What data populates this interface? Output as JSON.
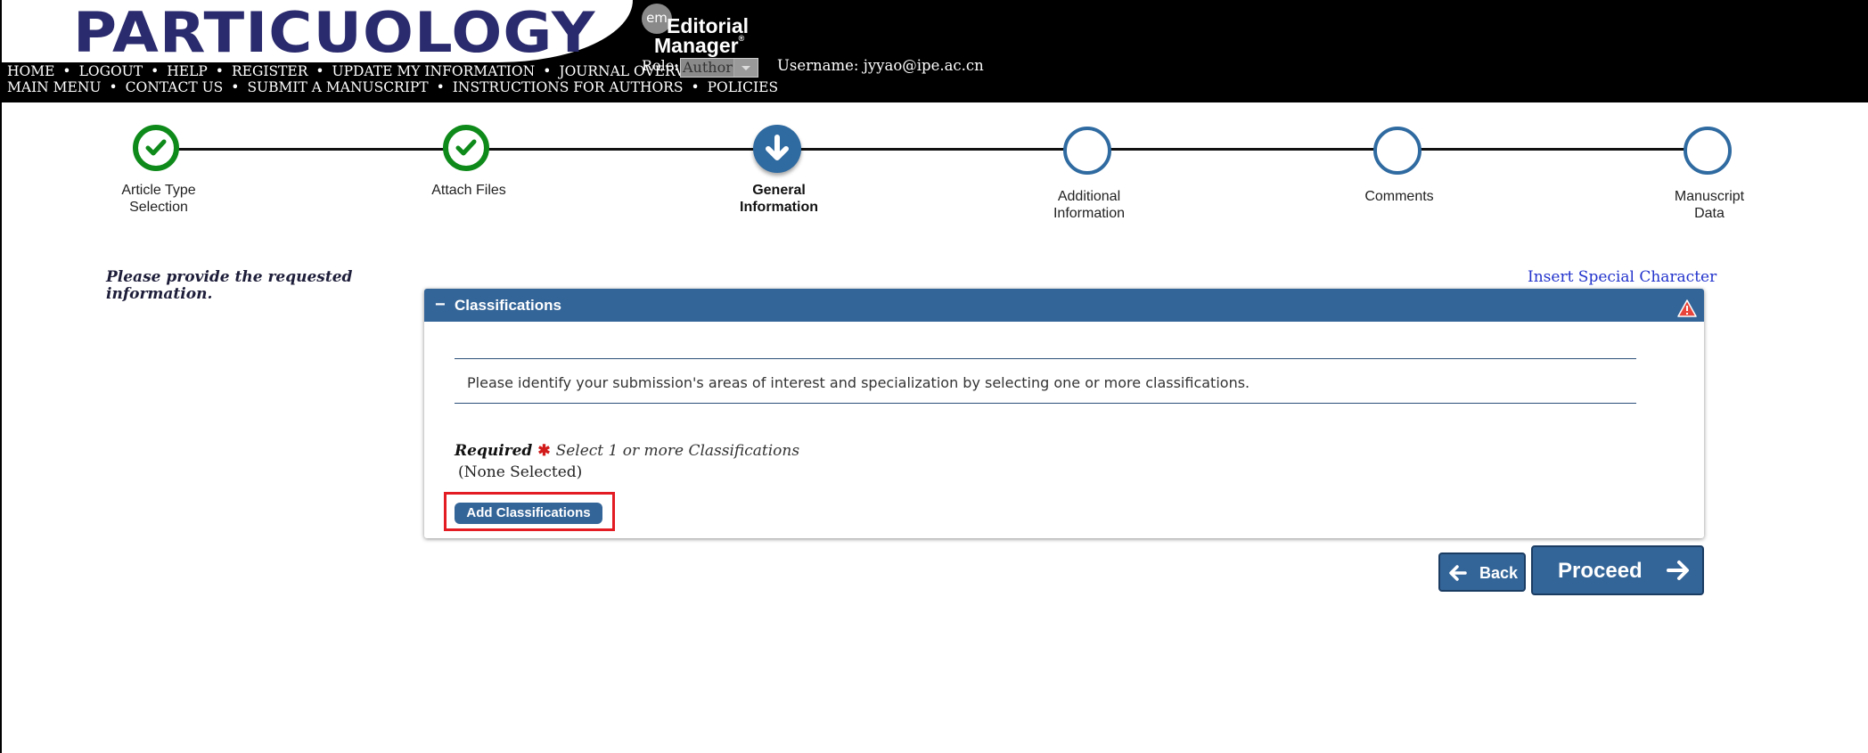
{
  "header": {
    "journal_logo": "PARTICUOLOGY",
    "em_badge": "em",
    "em_line1": "Editorial",
    "em_line2": "Manager",
    "em_mark": "®",
    "role_label": "Role:",
    "role_value": "Author",
    "username_label": "Username:",
    "username_value": "jyyao@ipe.ac.cn",
    "nav_row1": [
      "HOME",
      "LOGOUT",
      "HELP",
      "REGISTER",
      "UPDATE MY INFORMATION",
      "JOURNAL OVERVIEW"
    ],
    "nav_row2": [
      "MAIN MENU",
      "CONTACT US",
      "SUBMIT A MANUSCRIPT",
      "INSTRUCTIONS FOR AUTHORS",
      "POLICIES"
    ],
    "nav_separator": "•"
  },
  "steps": [
    {
      "label_line1": "Article Type",
      "label_line2": "Selection",
      "status": "done"
    },
    {
      "label_line1": "Attach Files",
      "label_line2": "",
      "status": "done"
    },
    {
      "label_line1": "General",
      "label_line2": "Information",
      "status": "current"
    },
    {
      "label_line1": "Additional",
      "label_line2": "Information",
      "status": "pending"
    },
    {
      "label_line1": "Comments",
      "label_line2": "",
      "status": "pending"
    },
    {
      "label_line1": "Manuscript",
      "label_line2": "Data",
      "status": "pending"
    }
  ],
  "main": {
    "instructions": "Please provide the requested information.",
    "insert_special_character": "Insert Special Character",
    "panel": {
      "collapse_symbol": "−",
      "title": "Classifications",
      "prompt": "Please identify your submission's areas of interest and specialization by selecting one or more classifications.",
      "required_label": "Required",
      "required_star": "✱",
      "required_hint": "Select 1 or more Classifications",
      "selection_status": "(None Selected)",
      "add_button": "Add Classifications"
    },
    "back_button": "Back",
    "proceed_button": "Proceed"
  },
  "colors": {
    "header_bg": "#000000",
    "logo_text": "#2a2a6e",
    "accent_blue": "#346598",
    "done_green": "#0e8a1a",
    "required_red": "#d21b1b",
    "highlight_red": "#e31b23",
    "link_blue": "#2233cc"
  }
}
